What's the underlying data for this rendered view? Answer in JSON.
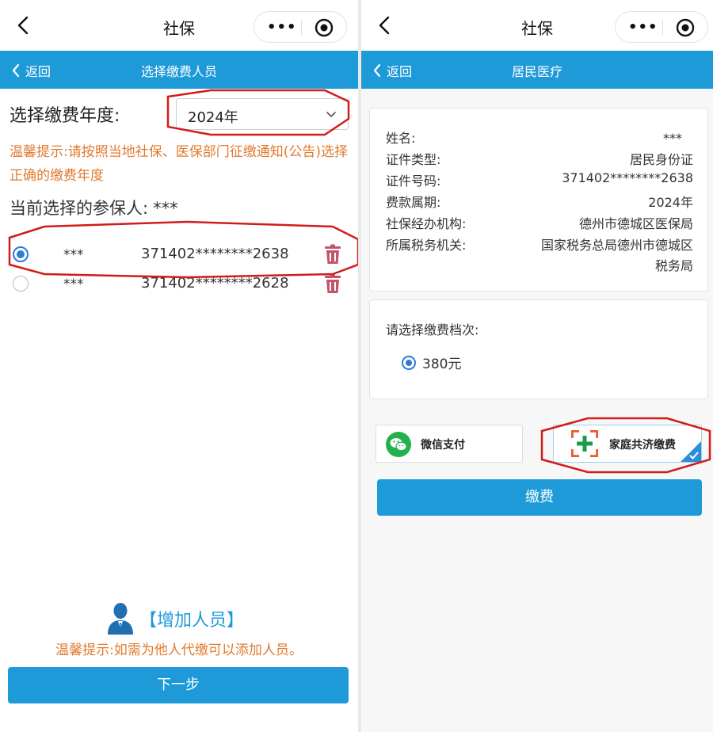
{
  "left": {
    "wx_title": "社保",
    "back_label": "返回",
    "page_title": "选择缴费人员",
    "year_label": "选择缴费年度:",
    "year_value": "2024年",
    "tip1": "温馨提示:请按照当地社保、医保部门征缴通知(公告)选择正确的缴费年度",
    "current_label": "当前选择的参保人:",
    "current_name": "***",
    "persons": [
      {
        "name": "***",
        "id": "371402********2638",
        "selected": true
      },
      {
        "name": "***",
        "id": "371402********2628",
        "selected": false
      }
    ],
    "add_label": "【增加人员】",
    "tip2": "温馨提示:如需为他人代缴可以添加人员。",
    "next_label": "下一步"
  },
  "right": {
    "wx_title": "社保",
    "back_label": "返回",
    "page_title": "居民医疗",
    "info": [
      {
        "key": "姓名:",
        "value": "***"
      },
      {
        "key": "证件类型:",
        "value": "居民身份证"
      },
      {
        "key": "证件号码:",
        "value": "371402********2638"
      },
      {
        "key": "费款属期:",
        "value": "2024年"
      },
      {
        "key": "社保经办机构:",
        "value": "德州市德城区医保局"
      },
      {
        "key": "所属税务机关:",
        "value": "国家税务总局德州市德城区",
        "value_line2": "税务局"
      }
    ],
    "tier_label": "请选择缴费档次:",
    "tier_option": "380元",
    "pay_wechat": "微信支付",
    "pay_family": "家庭共济缴费",
    "pay_button": "缴费"
  },
  "icons": {
    "wx_back": "chevron-left-icon",
    "more": "more-dots-icon",
    "target": "target-icon",
    "trash": "trash-icon",
    "person": "person-icon",
    "wechat": "wechat-icon",
    "family": "family-plus-icon",
    "check": "check-icon"
  },
  "colors": {
    "brand_blue": "#1f9ad8",
    "tip_orange": "#e07a2e",
    "radio_blue": "#2b7bd9",
    "trash": "#c2556b",
    "annotation_red": "#d11c1c"
  }
}
